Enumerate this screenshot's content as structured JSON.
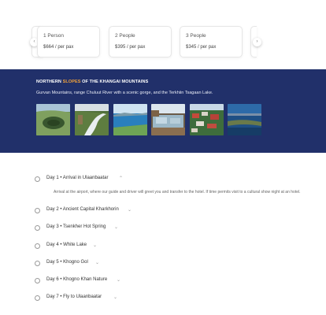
{
  "pricing": {
    "cards": [
      {
        "people": "1 Person",
        "price": "$664 / per pax"
      },
      {
        "people": "2 People",
        "price": "$395 / per pax"
      },
      {
        "people": "3 People",
        "price": "$345 / per pax"
      }
    ],
    "prev_icon": "chevron-left-icon",
    "next_icon": "chevron-right-icon"
  },
  "banner": {
    "title_prefix": "NORTHERN ",
    "title_highlight": "SLOPES",
    "title_suffix": " OF THE KHANGAI MOUNTAINS",
    "subtitle": "Gurvan Mountains, range Chuluut River with a scenic gorge, and the Terkhiin Tsagaan Lake.",
    "accent_color": "#f2a33a",
    "background_color": "#21306a"
  },
  "itinerary": {
    "days": [
      {
        "label": "Day 1 • Arrival in Ulaanbaatar",
        "expanded": true,
        "description": "Arrival at the airport, where our guide and driver will greet you and transfer to the hotel. If time permits visit to a cultural show night at an hotel."
      },
      {
        "label": "Day 2 • Ancient Capital Kharkhorin"
      },
      {
        "label": "Day 3 • Tsenkher Hot Spring"
      },
      {
        "label": "Day 4 • White Lake"
      },
      {
        "label": "Day 5 • Khogno Gol"
      },
      {
        "label": "Day 6 • Khogno Khan Nature"
      },
      {
        "label": "Day 7 • Fly to Ulaanbaatar"
      }
    ]
  }
}
